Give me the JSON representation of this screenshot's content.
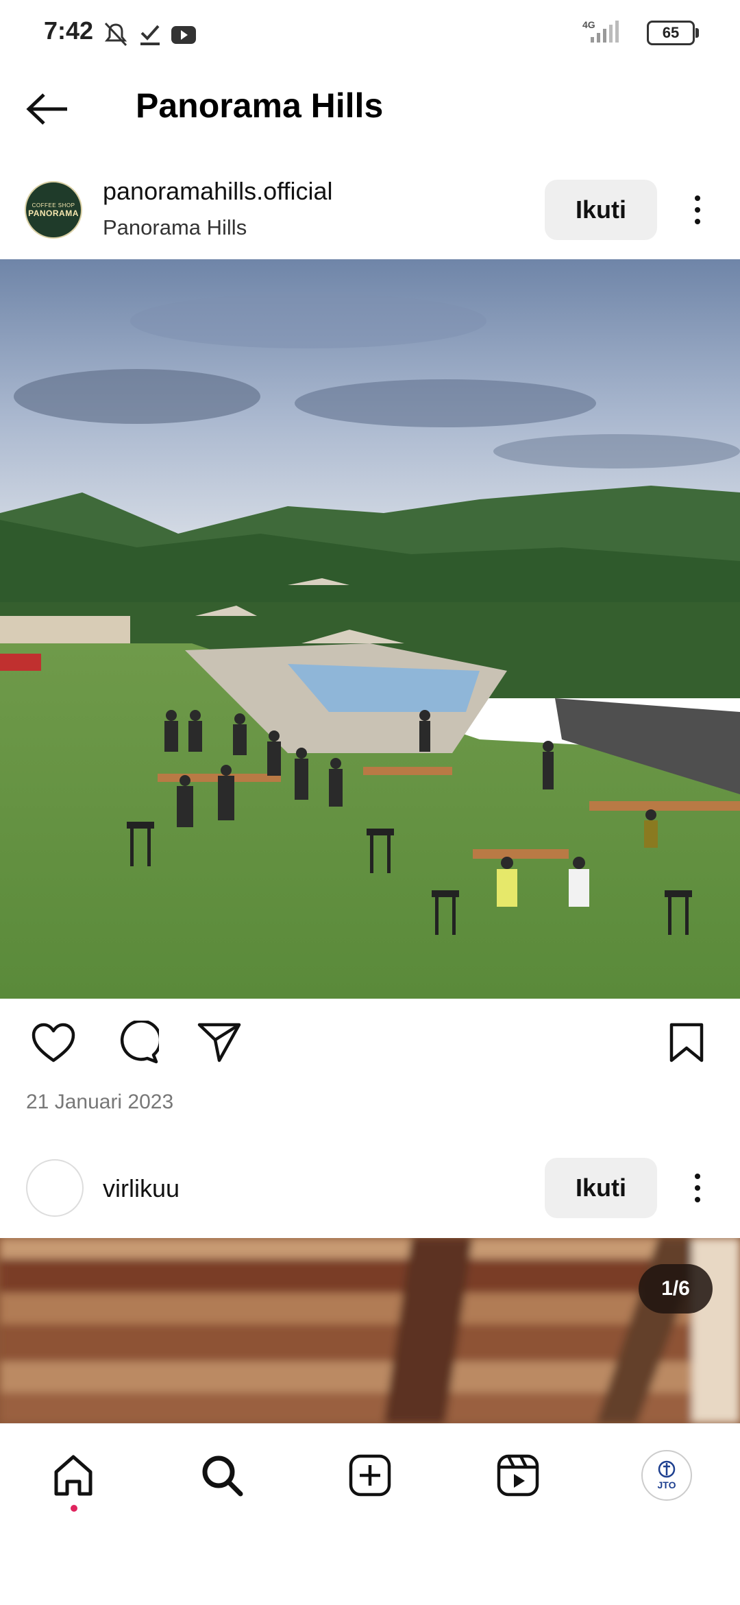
{
  "status_bar": {
    "time": "7:42",
    "network": "4G",
    "battery": "65",
    "icons": [
      "mute-icon",
      "check-icon",
      "youtube-icon",
      "signal-icon",
      "battery-icon"
    ]
  },
  "header": {
    "title": "Panorama Hills",
    "back_icon": "back-arrow-icon"
  },
  "post1": {
    "avatar_text": "PANORAMA",
    "avatar_sub": "COFFEE SHOP",
    "username": "panoramahills.official",
    "location": "Panorama Hills",
    "follow_label": "Ikuti",
    "date": "21 Januari 2023"
  },
  "post2": {
    "username": "virlikuu",
    "follow_label": "Ikuti",
    "counter": "1/6"
  },
  "bottom_nav": {
    "items": [
      "home-icon",
      "search-icon",
      "create-icon",
      "reels-icon",
      "profile-avatar"
    ],
    "profile_text": "JTO"
  },
  "colors": {
    "accent": "#e0245e",
    "button_bg": "#efefef"
  }
}
